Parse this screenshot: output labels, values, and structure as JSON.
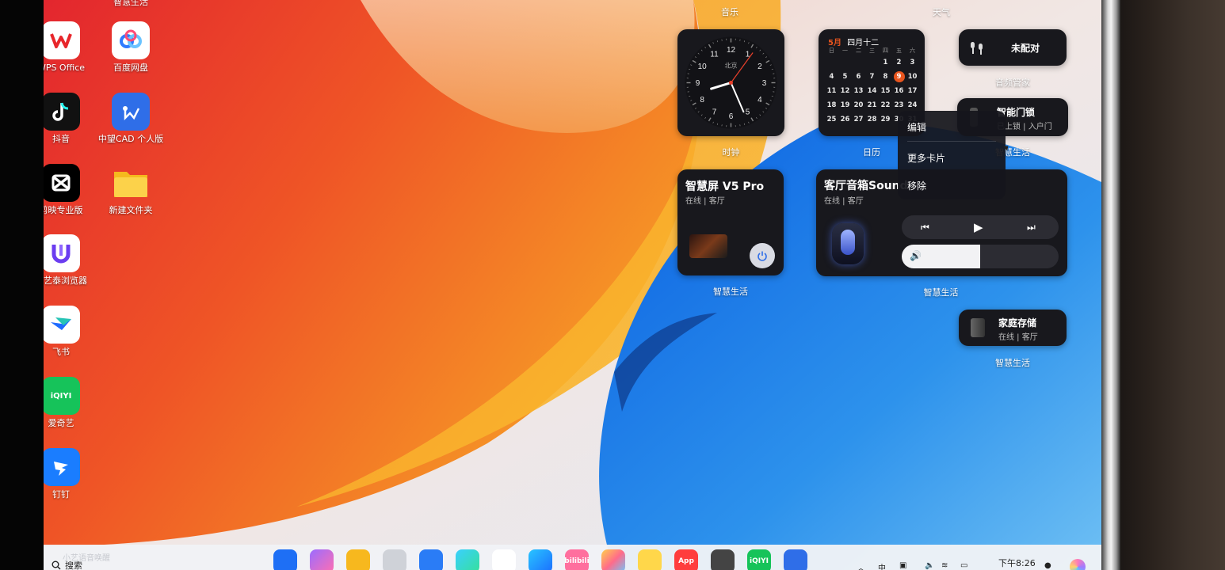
{
  "desktop_icons": [
    {
      "label": "WPS Office",
      "icon": "wps-icon"
    },
    {
      "label": "百度网盘",
      "icon": "baidu-netdisk-icon"
    },
    {
      "label": "抖音",
      "icon": "douyin-icon"
    },
    {
      "label": "中望CAD 个人版",
      "icon": "zwcad-icon"
    },
    {
      "label": "剪映专业版",
      "icon": "capcut-icon"
    },
    {
      "label": "新建文件夹",
      "icon": "folder-icon"
    },
    {
      "label": "小艺泰浏览器",
      "icon": "browser-icon"
    },
    {
      "label": "飞书",
      "icon": "feishu-icon"
    },
    {
      "label": "爱奇艺",
      "icon": "iqiyi-icon"
    },
    {
      "label": "钉钉",
      "icon": "dingtalk-icon"
    }
  ],
  "top_labels": {
    "top_left": "智慧生活",
    "music": "音乐",
    "weather": "天气"
  },
  "clock_widget": {
    "city": "北京",
    "label": "时钟",
    "hour": 8,
    "minute": 26,
    "second": 6,
    "numerals": [
      "12",
      "1",
      "2",
      "3",
      "4",
      "5",
      "6",
      "7",
      "8",
      "9",
      "10",
      "11"
    ]
  },
  "calendar_widget": {
    "month": "5月",
    "lunar": "四月十二",
    "weekdays": [
      "日",
      "一",
      "二",
      "三",
      "四",
      "五",
      "六"
    ],
    "rows": [
      [
        "",
        "",
        "",
        "",
        "1",
        "2",
        "3"
      ],
      [
        "4",
        "5",
        "6",
        "7",
        "8",
        "9",
        "10"
      ],
      [
        "11",
        "12",
        "13",
        "14",
        "15",
        "16",
        "17"
      ],
      [
        "18",
        "19",
        "20",
        "21",
        "22",
        "23",
        "24"
      ],
      [
        "25",
        "26",
        "27",
        "28",
        "29",
        "30",
        "31"
      ]
    ],
    "today": "9",
    "label": "日历"
  },
  "audio_widget": {
    "status": "未配对",
    "label": "音频管家"
  },
  "lock_widget": {
    "title": "智能门锁",
    "subtitle": "已上锁 | 入户门",
    "label": "智慧生活"
  },
  "context_menu": {
    "items": [
      "编辑",
      "更多卡片",
      "移除"
    ]
  },
  "screen_widget": {
    "title": "智慧屏 V5 Pro",
    "subtitle": "在线 | 客厅",
    "label": "智慧生活"
  },
  "speaker_widget": {
    "title": "客厅音箱Sound",
    "subtitle": "在线 | 客厅",
    "label": "智慧生活",
    "volume": 0.5
  },
  "storage_widget": {
    "title": "家庭存储",
    "subtitle": "在线 | 客厅",
    "label": "智慧生活"
  },
  "taskbar": {
    "search_label": "搜索",
    "search_hint": "小艺语音唤醒",
    "dock_apps": [
      {
        "name": "start-icon",
        "text": ""
      },
      {
        "name": "multitask-icon",
        "text": ""
      },
      {
        "name": "files-icon",
        "text": ""
      },
      {
        "name": "trash-icon",
        "text": ""
      },
      {
        "name": "store-icon",
        "text": ""
      },
      {
        "name": "video-icon",
        "text": ""
      },
      {
        "name": "feishu-dock-icon",
        "text": ""
      },
      {
        "name": "browser-dock-icon",
        "text": ""
      },
      {
        "name": "bilibili-icon",
        "text": "bilibili"
      },
      {
        "name": "gallery-icon",
        "text": ""
      },
      {
        "name": "notes-icon",
        "text": ""
      },
      {
        "name": "app-gallery-icon",
        "text": "App"
      },
      {
        "name": "settings-icon",
        "text": ""
      },
      {
        "name": "iqiyi-dock-icon",
        "text": "iQIYI"
      },
      {
        "name": "zwcad-dock-icon",
        "text": ""
      }
    ],
    "ime": "中",
    "time": "下午8:26"
  },
  "colors": {
    "accent": "#e8551e",
    "card": "#18181d",
    "menu": "rgba(22,22,28,0.93)"
  }
}
